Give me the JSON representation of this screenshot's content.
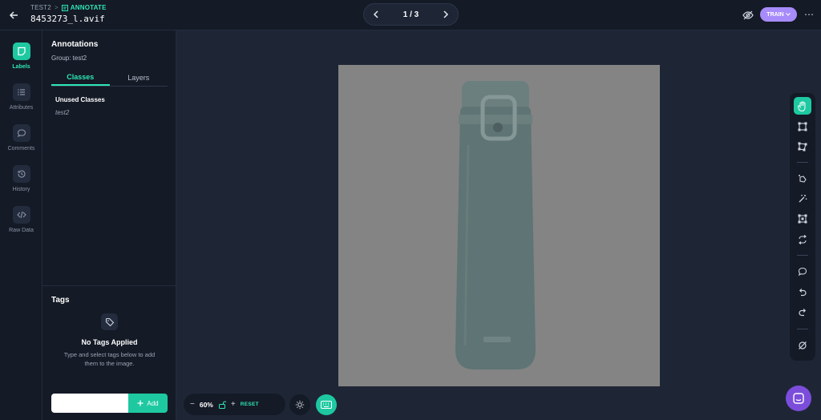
{
  "header": {
    "breadcrumb_project": "TEST2",
    "breadcrumb_sep": ">",
    "breadcrumb_mode": "ANNOTATE",
    "filename": "8453273_l.avif",
    "pager": "1 / 3",
    "train_label": "TRAIN",
    "more_label": "⋯"
  },
  "rail": {
    "items": [
      {
        "label": "Labels",
        "icon": "labels-icon"
      },
      {
        "label": "Attributes",
        "icon": "attributes-icon"
      },
      {
        "label": "Comments",
        "icon": "comments-icon"
      },
      {
        "label": "History",
        "icon": "history-icon"
      },
      {
        "label": "Raw Data",
        "icon": "code-icon"
      }
    ]
  },
  "panel": {
    "title": "Annotations",
    "group": "Group: test2",
    "tabs": [
      "Classes",
      "Layers"
    ],
    "unused_title": "Unused Classes",
    "classes": [
      "test2"
    ],
    "tags_title": "Tags",
    "no_tags": "No Tags Applied",
    "no_tags_desc": "Type and select tags below to add them to the image.",
    "add_label": "Add",
    "tag_input_value": ""
  },
  "zoom": {
    "minus": "−",
    "percent": "60%",
    "plus": "+",
    "reset": "RESET"
  },
  "colors": {
    "accent": "#1ec9a1",
    "accent_text": "#2ee6b6",
    "train": "#a78bfa",
    "chat": "#7c4ddb",
    "image_bg": "#848484",
    "bottle": "#5f7474"
  }
}
